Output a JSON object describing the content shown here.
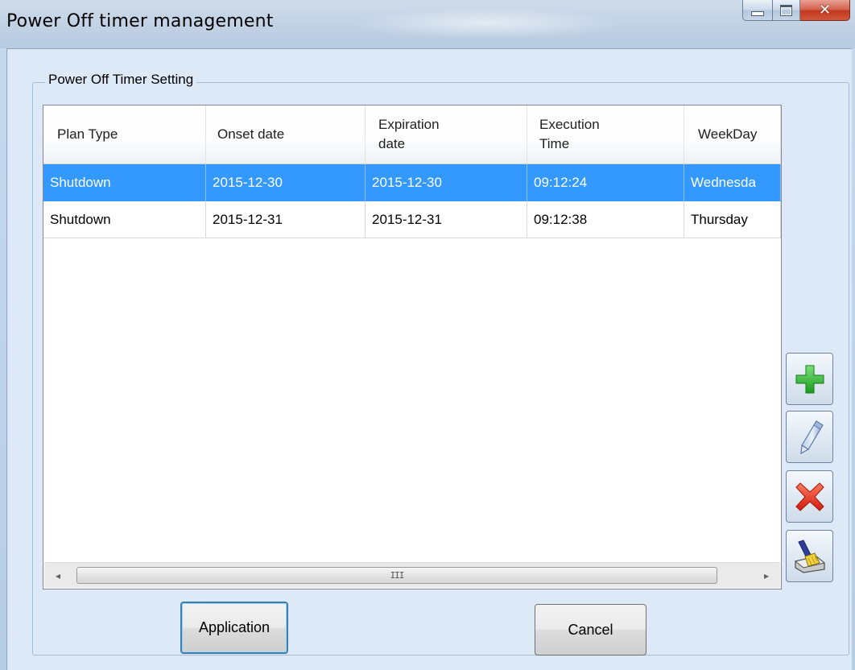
{
  "window": {
    "title": "Power Off timer management",
    "controls": {
      "minimize": "minimize-icon",
      "maximize": "maximize-icon",
      "close": "close-icon"
    }
  },
  "group": {
    "title": "Power Off Timer Setting"
  },
  "table": {
    "columns": [
      {
        "key": "plan_type",
        "label": "Plan Type"
      },
      {
        "key": "onset",
        "label": "Onset date"
      },
      {
        "key": "expiration",
        "label": "Expiration\ndate"
      },
      {
        "key": "exec_time",
        "label": "Execution\nTime"
      },
      {
        "key": "weekday",
        "label": "WeekDay"
      }
    ],
    "rows": [
      {
        "plan_type": "Shutdown",
        "onset": "2015-12-30",
        "expiration": "2015-12-30",
        "exec_time": "09:12:24",
        "weekday": "Wednesda",
        "selected": true
      },
      {
        "plan_type": "Shutdown",
        "onset": "2015-12-31",
        "expiration": "2015-12-31",
        "exec_time": "09:12:38",
        "weekday": "Thursday",
        "selected": false
      }
    ],
    "scrollbar": {
      "left_arrow": "◂",
      "right_arrow": "▸",
      "grip": "III"
    }
  },
  "side_buttons": [
    {
      "name": "add-button",
      "icon": "plus-icon",
      "color": "#2bb52e"
    },
    {
      "name": "edit-button",
      "icon": "pencil-icon",
      "color": "#6f93c8"
    },
    {
      "name": "delete-button",
      "icon": "red-x-icon",
      "color": "#e0261b"
    },
    {
      "name": "clear-button",
      "icon": "brush-clear-icon",
      "color": "#e8c830"
    }
  ],
  "footer": {
    "apply_label": "Application",
    "cancel_label": "Cancel"
  },
  "colors": {
    "selection": "#3399ff",
    "accent_border": "#3c7fb1"
  }
}
